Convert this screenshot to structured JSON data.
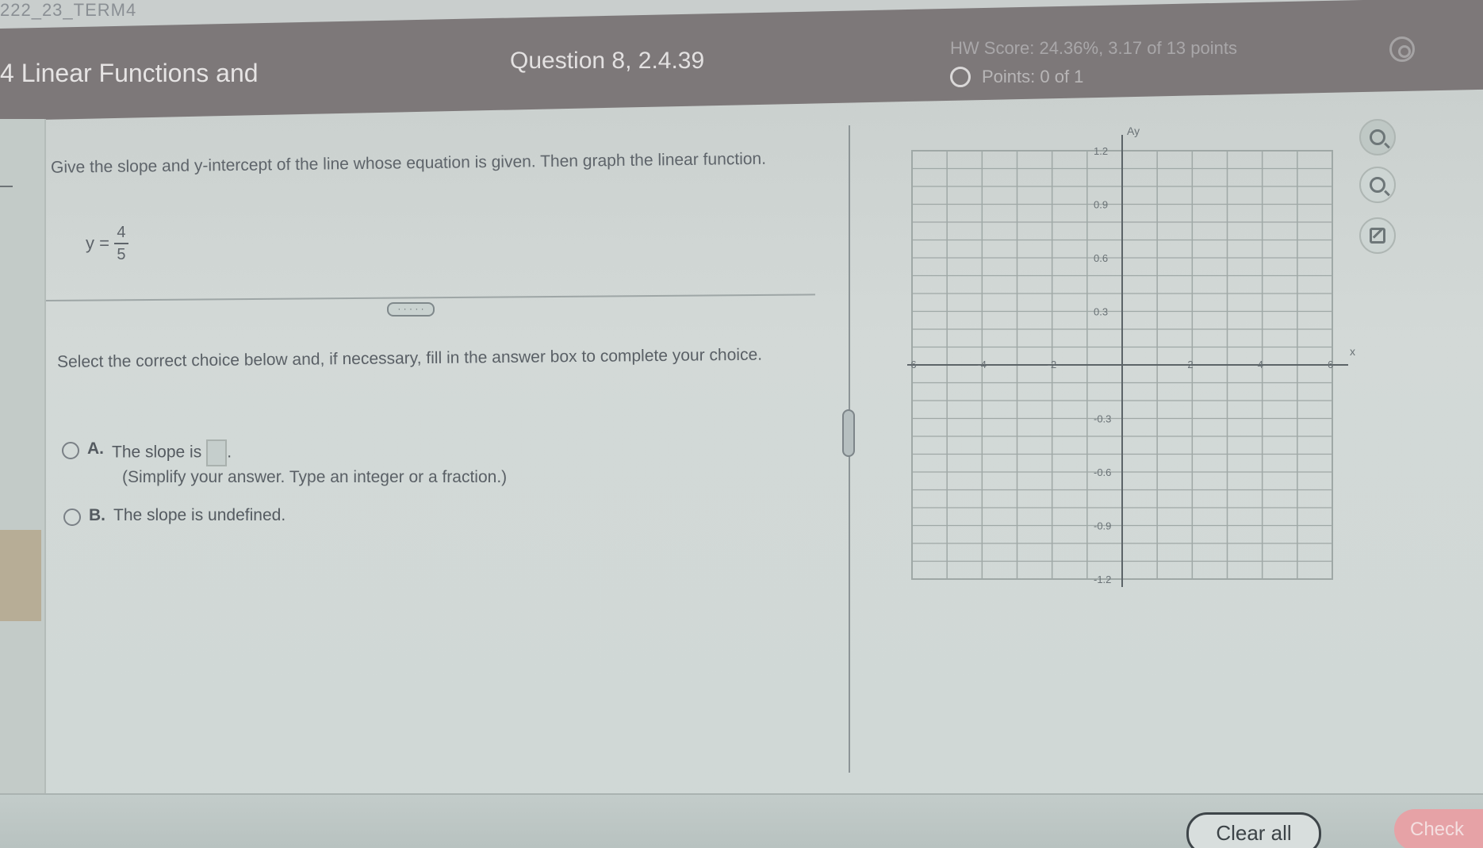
{
  "top_strip": {
    "crumb": "222_23_TERM4"
  },
  "header": {
    "module_title": "4 Linear Functions and",
    "question_label": "Question 8, 2.4.39",
    "hw_score": "HW Score: 24.36%, 3.17 of 13 points",
    "points": "Points: 0 of 1"
  },
  "question": {
    "prompt": "Give the slope and y-intercept of the line whose equation is given. Then graph the linear function.",
    "equation": {
      "lhs": "y =",
      "numerator": "4",
      "denominator": "5"
    },
    "more_label": "· · · · ·",
    "instructions": "Select the correct choice below and, if necessary, fill in the answer box to complete your choice.",
    "choices": [
      {
        "letter": "A.",
        "text": "The slope is",
        "suffix": "."
      },
      {
        "letter": "B.",
        "text": "The slope is undefined."
      }
    ],
    "hint": "(Simplify your answer. Type an integer or a fraction.)"
  },
  "graph": {
    "y_axis_label": "Ay",
    "x_axis_label": "x",
    "y_ticks": [
      "1.2",
      "0.9",
      "0.6",
      "0.3",
      "-0.3",
      "-0.6",
      "-0.9",
      "-1.2"
    ],
    "x_ticks": [
      "-6",
      "-4",
      "-2",
      "2",
      "4",
      "6"
    ],
    "tools": [
      "zoom-in-icon",
      "zoom-out-icon",
      "edit-icon"
    ]
  },
  "footer": {
    "clear_all": "Clear all",
    "check_answer": "Check"
  },
  "colors": {
    "header": "#7d7879",
    "accent_check": "#e6a2a6",
    "grid": "#9fa8a6"
  }
}
